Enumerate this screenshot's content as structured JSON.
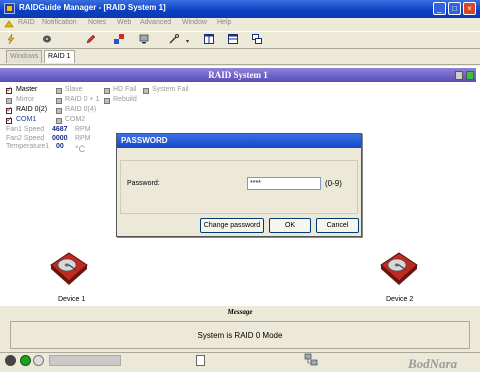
{
  "window": {
    "title": "RAIDGuide Manager - [RAID System 1]"
  },
  "menu": [
    "RAID",
    "Notification",
    "Notes",
    "Web",
    "Advanced",
    "Window",
    "Help"
  ],
  "tabs": [
    "Windows",
    "RAID 1"
  ],
  "raid_header": "RAID System 1",
  "status": {
    "master": "Master",
    "slave": "Slave",
    "hd_fail": "HD Fail",
    "system_fail": "System Fail",
    "mirror": "Mirror",
    "raid01": "RAID 0 + 1",
    "rebuild": "Rebuild",
    "raid0_2": "RAID 0(2)",
    "raid0_4": "RAID 0(4)",
    "com1": "COM1",
    "com2": "COM2"
  },
  "sensors": {
    "fan1_label": "Fan1 Speed",
    "fan1_value": "4687",
    "fan1_unit": "RPM",
    "fan2_label": "Fan2 Speed",
    "fan2_value": "0000",
    "fan2_unit": "RPM",
    "temp_label": "Temperature1",
    "temp_value": "00",
    "temp_unit": "°C"
  },
  "devices": {
    "left": "Device 1",
    "right": "Device 2"
  },
  "dialog": {
    "title": "PASSWORD",
    "password_label": "Password:",
    "password_value": "****",
    "hint": "(0-9)",
    "change_button": "Change password",
    "ok_button": "OK",
    "cancel_button": "Cancel"
  },
  "message": {
    "title": "Message",
    "text": "System is RAID 0 Mode"
  },
  "watermark": "BodNara",
  "colors": {
    "title_bar": "#0a3fc0",
    "raid_header": "#6a5ec8",
    "accent_red": "#cc0000"
  }
}
